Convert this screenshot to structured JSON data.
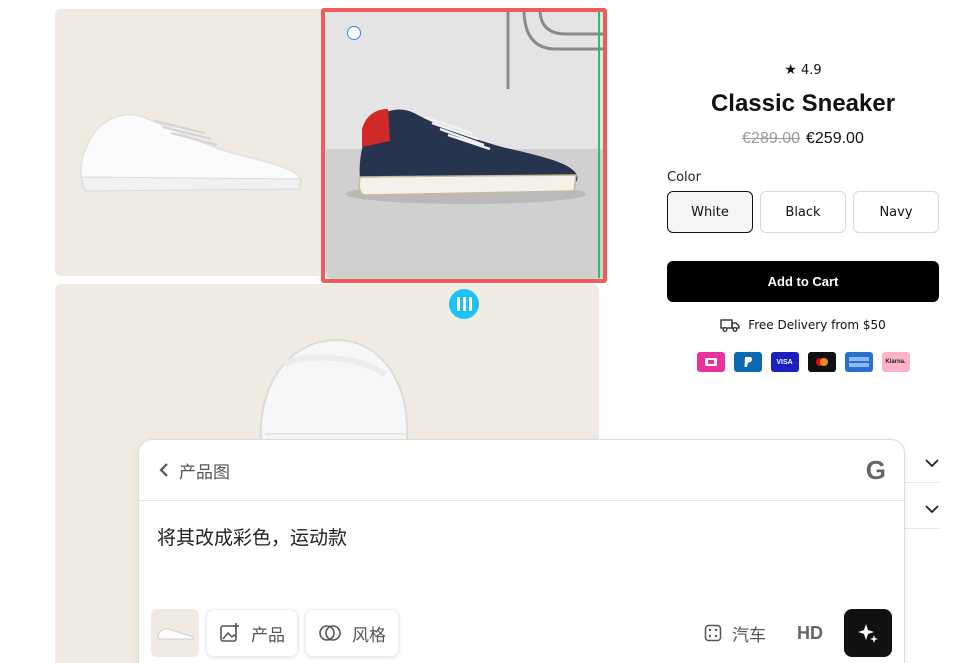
{
  "product": {
    "rating": "4.9",
    "star_icon": "star-icon",
    "title": "Classic Sneaker",
    "old_price": "€289.00",
    "price": "€259.00",
    "color_label": "Color",
    "colors": [
      "White",
      "Black",
      "Navy"
    ],
    "selected_color": "White",
    "add_to_cart": "Add to Cart",
    "delivery": "Free Delivery from $50",
    "payment_methods": [
      {
        "name": "iDEAL",
        "color": "#e7339b"
      },
      {
        "name": "PayPal",
        "color": "#0c6ab2"
      },
      {
        "name": "VISA",
        "color": "#1a1fbf"
      },
      {
        "name": "Mastercard",
        "color": "#111111"
      },
      {
        "name": "American Express",
        "color": "#2a6fcf"
      },
      {
        "name": "Klarna.",
        "color": "#ffb3c7"
      }
    ]
  },
  "panel": {
    "back_label": "产品图",
    "logo_letter": "G",
    "prompt": "将其改成彩色，运动款",
    "chip_product": "产品",
    "chip_style": "风格",
    "category": "汽车",
    "quality": "HD"
  },
  "colors": {
    "selection": "#ef5a5a",
    "handle": "#1ec1f5",
    "accent_black": "#000000"
  }
}
